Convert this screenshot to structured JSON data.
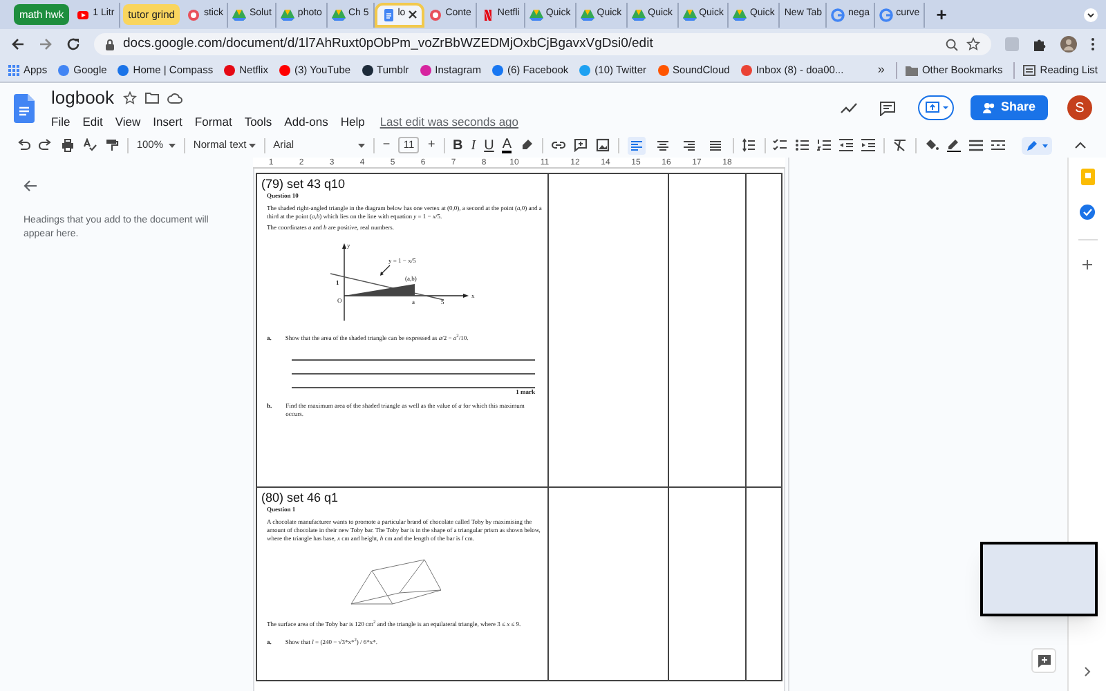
{
  "tabs": [
    {
      "label": "math hwk",
      "kind": "group",
      "color": "#1e8e3e",
      "selected": false
    },
    {
      "label": "1 Litr",
      "kind": "youtube",
      "selected": false
    },
    {
      "label": "tutor grind",
      "kind": "group",
      "color": "#f9d55e",
      "selected": false
    },
    {
      "label": "stick",
      "kind": "site",
      "selected": false
    },
    {
      "label": "Solut",
      "kind": "drive",
      "selected": false
    },
    {
      "label": "photo",
      "kind": "drive",
      "selected": false
    },
    {
      "label": "Ch 5",
      "kind": "drive",
      "selected": false
    },
    {
      "label": "lo",
      "kind": "docs",
      "selected": true
    },
    {
      "label": "Conte",
      "kind": "site",
      "selected": false
    },
    {
      "label": "Netfli",
      "kind": "netflix",
      "selected": false
    },
    {
      "label": "Quick",
      "kind": "drive",
      "selected": false
    },
    {
      "label": "Quick",
      "kind": "drive",
      "selected": false
    },
    {
      "label": "Quick",
      "kind": "drive",
      "selected": false
    },
    {
      "label": "Quick",
      "kind": "drive",
      "selected": false
    },
    {
      "label": "Quick",
      "kind": "drive",
      "selected": false
    },
    {
      "label": "New Tab",
      "kind": "plain",
      "selected": false
    },
    {
      "label": "nega",
      "kind": "google",
      "selected": false
    },
    {
      "label": "curve",
      "kind": "google",
      "selected": false
    }
  ],
  "new_tab": "+",
  "address": {
    "url": "docs.google.com/document/d/1l7AhRuxt0pObPm_voZrBbWZEDMjOxbCjBgavxVgDsi0/edit"
  },
  "bookmarks": [
    {
      "label": "Apps",
      "color": "#4285f4"
    },
    {
      "label": "Google",
      "color": "#4285f4"
    },
    {
      "label": "Home | Compass",
      "color": "#1a73e8"
    },
    {
      "label": "Netflix",
      "color": "#e50914"
    },
    {
      "label": "(3) YouTube",
      "color": "#ff0000"
    },
    {
      "label": "Tumblr",
      "color": "#1d2b3a"
    },
    {
      "label": "Instagram",
      "color": "#d6249f"
    },
    {
      "label": "(6) Facebook",
      "color": "#1877f2"
    },
    {
      "label": "(10) Twitter",
      "color": "#1da1f2"
    },
    {
      "label": "SoundCloud",
      "color": "#ff5500"
    },
    {
      "label": "Inbox (8) - doa00...",
      "color": "#ea4335"
    }
  ],
  "bookmarks_more": "»",
  "other_bookmarks": "Other Bookmarks",
  "reading_list": "Reading List",
  "doc": {
    "title": "logbook",
    "menu": [
      "File",
      "Edit",
      "View",
      "Insert",
      "Format",
      "Tools",
      "Add-ons",
      "Help"
    ],
    "last_edit": "Last edit was seconds ago",
    "share": "Share",
    "avatar": "S"
  },
  "toolbar": {
    "zoom": "100%",
    "style": "Normal text",
    "font": "Arial",
    "size": "11",
    "size_minus": "−",
    "size_plus": "+",
    "format_glyphs": [
      "B",
      "I",
      "U",
      "A"
    ],
    "align": [
      {
        "selected": true
      },
      {
        "selected": false
      },
      {
        "selected": false
      },
      {
        "selected": false
      }
    ]
  },
  "ruler": [
    "1",
    "2",
    "3",
    "4",
    "5",
    "6",
    "7",
    "8",
    "10",
    "11",
    "12",
    "14",
    "15",
    "16",
    "17",
    "18"
  ],
  "outline": {
    "hint": "Headings that you add to the document will appear here."
  },
  "table": {
    "rows": [
      {
        "title": "(79) set 43 q10",
        "kind": "graph",
        "question": {
          "number": "Question 10",
          "paragraphs": [
            "The shaded right-angled triangle in the diagram below has one vertex at (0,0), a second at the point (*a*,0) and a third at the point (*a*,*b*) which lies on the line with equation *y* = 1 − *x*/5.",
            "The coordinates *a* and *b* are positive, real numbers."
          ],
          "labels": {
            "y": "y",
            "x": "x",
            "origin": "O",
            "one": "1",
            "five": "5",
            "a": "a",
            "point": "(a,b)",
            "line": "y = 1 − x/5"
          },
          "parts": [
            {
              "letter": "a.",
              "text": "Show that the area of the shaded triangle can be expressed as *a*/2 − *a*$^{2}$/10.",
              "kind": "answer_lines",
              "mark": "1 mark"
            },
            {
              "kind": "plain",
              "letter": "b.",
              "text": "Find the maximum area of the shaded triangle as well as the value of *a* for which this maximum occurs."
            }
          ]
        }
      },
      {
        "title": "(80) set 46 q1",
        "kind": "prism",
        "question": {
          "number": "Question 1",
          "paragraphs": [
            "A chocolate manufacturer wants to promote a particular brand of chocolate called Toby by maximising the amount of chocolate in their new Toby bar. The Toby bar is in the shape of a triangular prism as shown below, where the triangle has base, *x* cm and height, *h* cm and the length of the bar is *l* cm."
          ],
          "after": "The surface area of the Toby bar is 120 cm$^{2}$ and the triangle is an equilateral triangle, where 3 ≤ *x* ≤ 9.",
          "parts": [
            {
              "kind": "plain",
              "letter": "a.",
              "text": "Show that *l* = (240 − √3*x*$^{2}$) / 6*x*."
            }
          ]
        }
      }
    ]
  }
}
